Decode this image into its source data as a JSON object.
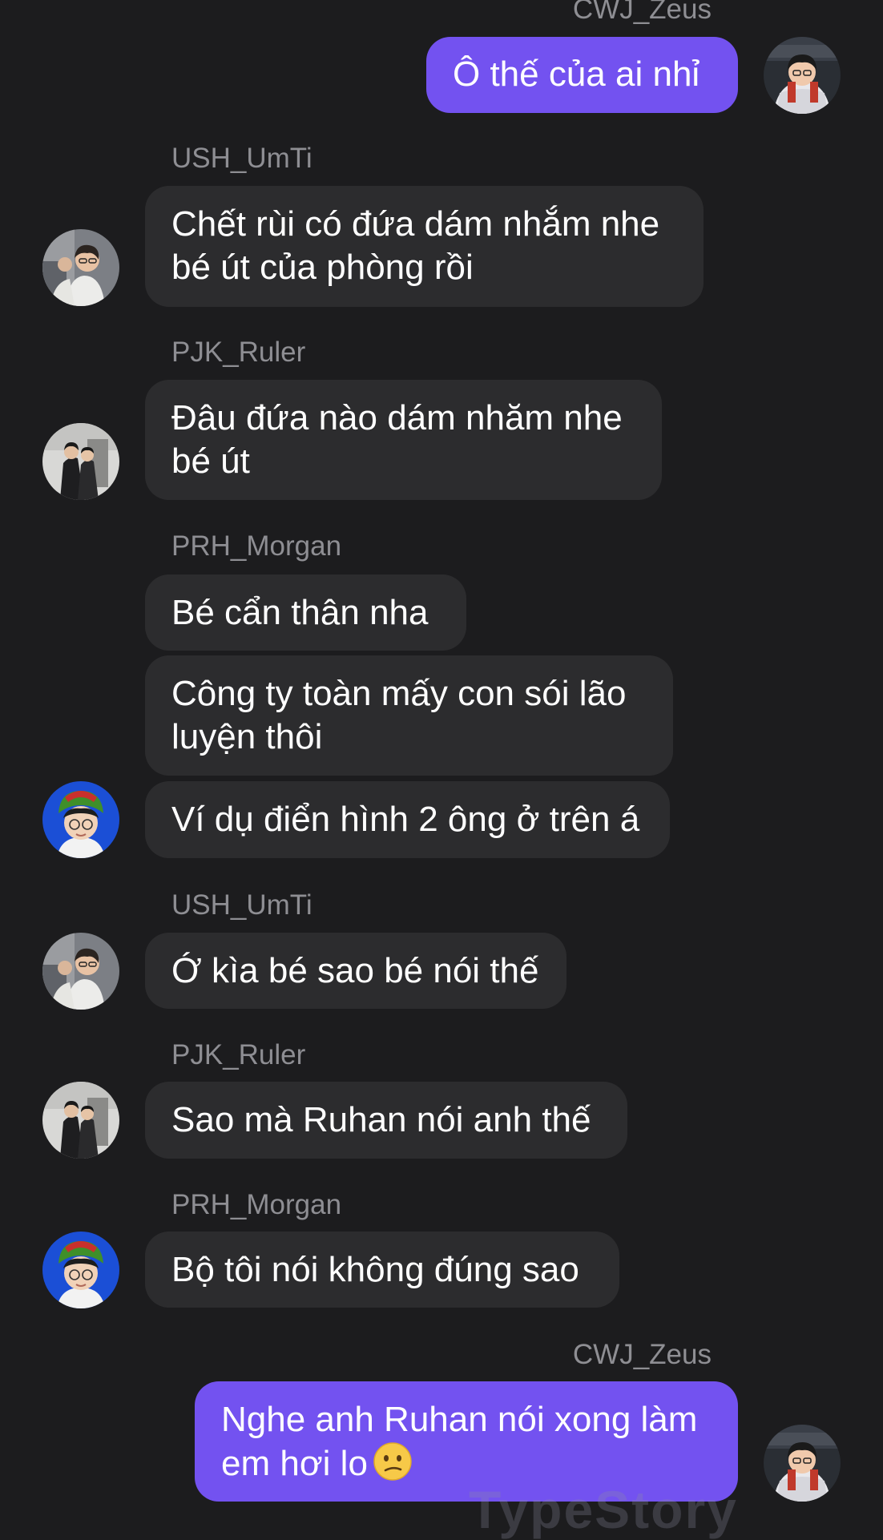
{
  "messages": [
    {
      "sender": "CWJ_Zeus",
      "text": "Ô thế của ai nhỉ"
    },
    {
      "sender": "USH_UmTi",
      "lines": [
        "Chết rùi có đứa dám nhắm nhe",
        "bé út của phòng rồi"
      ]
    },
    {
      "sender": "PJK_Ruler",
      "lines": [
        "Đâu đứa nào dám nhăm nhe",
        "bé út"
      ]
    },
    {
      "sender": "PRH_Morgan",
      "texts": [
        "Bé cẩn thân nha",
        "Công ty toàn mấy con sói lão",
        "luyện thôi",
        "Ví dụ điển hình 2 ông ở trên á"
      ]
    },
    {
      "sender": "USH_UmTi",
      "text": "Ớ kìa bé sao bé nói thế"
    },
    {
      "sender": "PJK_Ruler",
      "text": "Sao mà Ruhan nói anh thế"
    },
    {
      "sender": "PRH_Morgan",
      "text": "Bộ tôi nói không đúng sao"
    },
    {
      "sender": "CWJ_Zeus",
      "lines": [
        "Nghe anh Ruhan nói xong làm",
        "em hơi lo"
      ],
      "emoji": "worried-face"
    }
  ],
  "watermark": "TypeStory",
  "colors": {
    "background": "#1c1c1e",
    "received_bubble": "#2c2c2e",
    "sent_bubble": "#7352f0",
    "sender_name": "#8e8e93"
  }
}
